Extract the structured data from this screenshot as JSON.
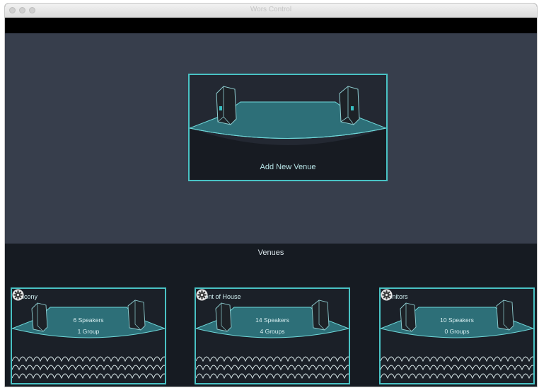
{
  "window": {
    "title": "Wors Control"
  },
  "add_venue": {
    "label": "Add New Venue"
  },
  "venues_section": {
    "heading": "Venues",
    "cards": [
      {
        "name": "Balcony",
        "speakers": "6 Speakers",
        "groups": "1 Group"
      },
      {
        "name": "Front of House",
        "speakers": "14 Speakers",
        "groups": "4 Groups"
      },
      {
        "name": "Monitors",
        "speakers": "10 Speakers",
        "groups": "0 Groups"
      }
    ]
  },
  "colors": {
    "accent": "#49c2c4",
    "upper_bg": "#373e4c",
    "lower_bg": "#161b22",
    "toolbar_bg": "#000000"
  },
  "icons": [
    "close-dot-icon",
    "minimize-dot-icon",
    "zoom-dot-icon",
    "speaker-icon",
    "gear-icon"
  ]
}
